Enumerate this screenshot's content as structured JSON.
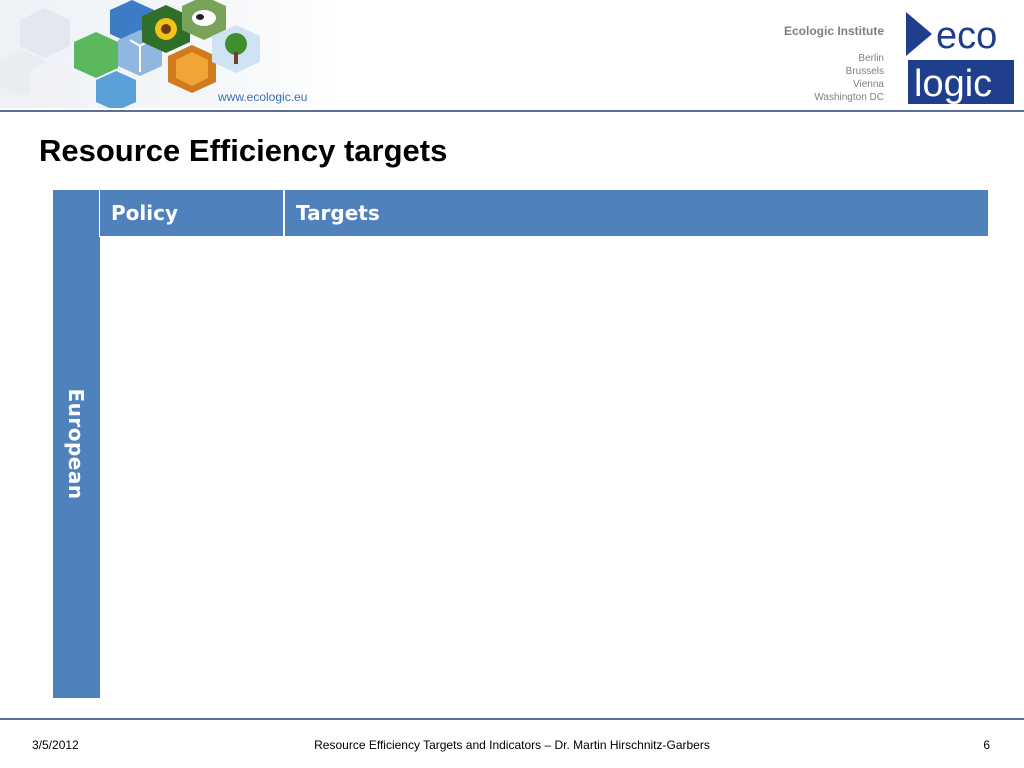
{
  "header": {
    "url": "www.ecologic.eu",
    "institute_name": "Ecologic Institute",
    "cities": [
      "Berlin",
      "Brussels",
      "Vienna",
      "Washington DC"
    ],
    "logo_word_top": "eco",
    "logo_word_bottom": "logic",
    "colors": {
      "accent_blue": "#4f81bd",
      "logo_navy": "#1f3e8c",
      "rule": "#5b6e9c",
      "url_blue": "#3d6fb4"
    }
  },
  "slide": {
    "title": "Resource Efficiency targets"
  },
  "table": {
    "side_label": "European",
    "columns": [
      "Policy",
      "Targets"
    ],
    "rows": []
  },
  "footer": {
    "date": "3/5/2012",
    "center_text": "Resource Efficiency Targets and Indicators – Dr. Martin Hirschnitz-Garbers",
    "page_number": "6"
  }
}
